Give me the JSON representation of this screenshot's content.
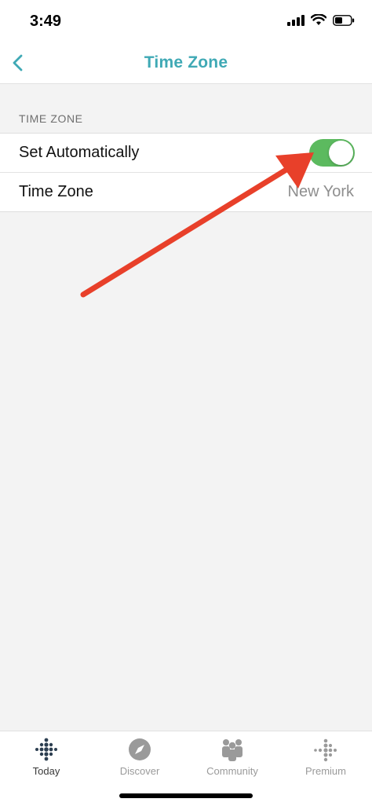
{
  "status_bar": {
    "time": "3:49"
  },
  "nav": {
    "title": "Time Zone"
  },
  "section": {
    "header": "TIME ZONE"
  },
  "rows": [
    {
      "label": "Set Automatically",
      "toggle_on": true
    },
    {
      "label": "Time Zone",
      "value": "New York"
    }
  ],
  "tabs": [
    {
      "label": "Today",
      "icon": "fitbit-dots-icon",
      "active": true
    },
    {
      "label": "Discover",
      "icon": "compass-icon",
      "active": false
    },
    {
      "label": "Community",
      "icon": "people-icon",
      "active": false
    },
    {
      "label": "Premium",
      "icon": "premium-dots-icon",
      "active": false
    }
  ],
  "colors": {
    "accent": "#3fa9b5",
    "toggle_on": "#5cba5f",
    "annotation_arrow": "#e8402a"
  }
}
